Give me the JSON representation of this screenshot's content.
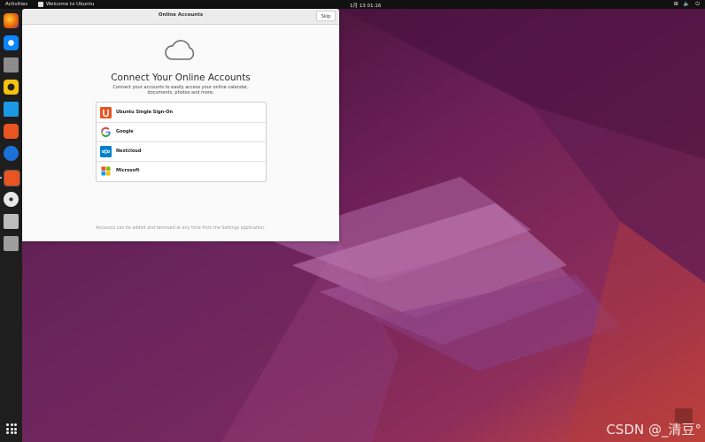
{
  "topbar": {
    "activities": "Activities",
    "app_title": "Welcome to Ubuntu",
    "clock": "1月 13  01:16",
    "tray_icons": [
      "network-icon",
      "volume-icon",
      "power-icon"
    ]
  },
  "dock": {
    "items": [
      {
        "name": "firefox",
        "color": "#e66000"
      },
      {
        "name": "thunderbird",
        "color": "#0a84ff"
      },
      {
        "name": "files",
        "color": "#8c8c8c"
      },
      {
        "name": "rhythmbox",
        "color": "#f5c211"
      },
      {
        "name": "writer",
        "color": "#1c99e4"
      },
      {
        "name": "software",
        "color": "#e95420"
      },
      {
        "name": "help",
        "color": "#1c71d8"
      },
      {
        "name": "installer",
        "color": "#e95420"
      },
      {
        "name": "dvd",
        "color": "#e8e8e8"
      },
      {
        "name": "drive",
        "color": "#bdbdbd"
      },
      {
        "name": "trash",
        "color": "#9e9e9e"
      }
    ]
  },
  "window": {
    "title": "Online Accounts",
    "skip_label": "Skip",
    "heading": "Connect Your Online Accounts",
    "description": "Connect your accounts to easily access your online calendar, documents, photos and more.",
    "accounts": [
      {
        "label": "Ubuntu Single Sign-On",
        "icon": "ubuntu-sso-icon"
      },
      {
        "label": "Google",
        "icon": "google-icon"
      },
      {
        "label": "Nextcloud",
        "icon": "nextcloud-icon"
      },
      {
        "label": "Microsoft",
        "icon": "microsoft-icon"
      }
    ],
    "footer": "Accounts can be added and removed at any time from the Settings application."
  },
  "watermark": "CSDN @_清豆°",
  "colors": {
    "wallpaper_dark": "#3d0f2c",
    "wallpaper_purple": "#7a2a6a",
    "wallpaper_orange": "#c8473a",
    "ubuntu_orange": "#e95420"
  }
}
